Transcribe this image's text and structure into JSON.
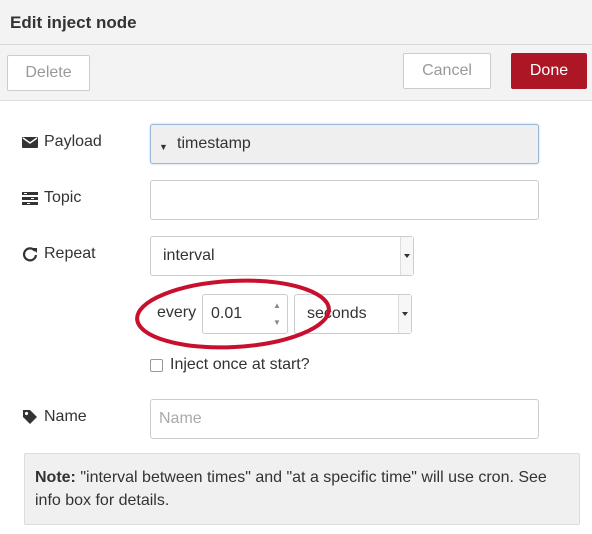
{
  "dialog": {
    "title": "Edit inject node"
  },
  "toolbar": {
    "delete_label": "Delete",
    "cancel_label": "Cancel",
    "done_label": "Done"
  },
  "payload": {
    "label": "Payload",
    "icon": "envelope-icon",
    "value": "timestamp"
  },
  "topic": {
    "label": "Topic",
    "icon": "tasks-icon",
    "value": ""
  },
  "repeat": {
    "label": "Repeat",
    "icon": "repeat-icon",
    "mode": "interval",
    "every_label": "every",
    "interval_value": "0.01",
    "units": "seconds"
  },
  "inject_once": {
    "label": "Inject once at start?",
    "checked": false
  },
  "name": {
    "label": "Name",
    "icon": "tag-icon",
    "placeholder": "Name",
    "value": ""
  },
  "note": {
    "prefix": "Note:",
    "text": " \"interval between times\" and \"at a specific time\" will use cron. See info box for details."
  },
  "colors": {
    "done_button": "#ad1625",
    "annotation": "#c8102e"
  }
}
